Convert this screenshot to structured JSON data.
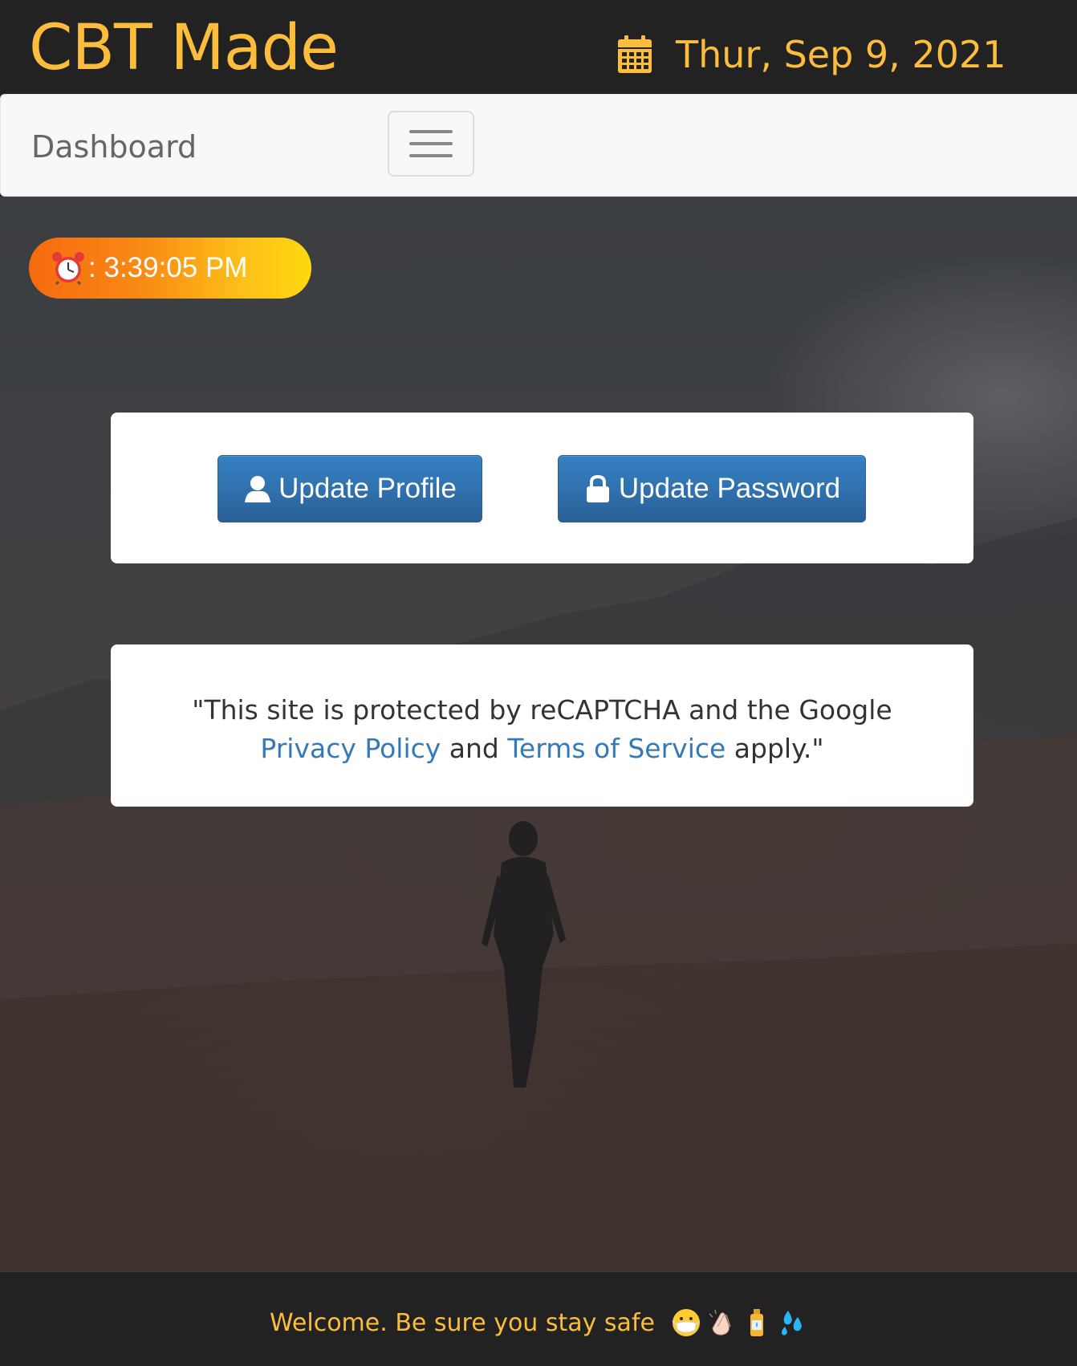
{
  "header": {
    "brand": "CBT Made",
    "date": "Thur, Sep 9, 2021",
    "brand_color": "#fbbd3b"
  },
  "navbar": {
    "brand_label": "Dashboard",
    "toggle_icon": "hamburger-menu-icon"
  },
  "clock": {
    "icon": "alarm-clock-icon",
    "time": ": 3:39:05 PM"
  },
  "actions": {
    "update_profile": "Update Profile",
    "update_password": "Update Password",
    "profile_icon": "user-icon",
    "password_icon": "lock-icon",
    "button_color": "#337ab7"
  },
  "notice": {
    "prefix": "\"This site is protected by reCAPTCHA and the Google ",
    "privacy_link": "Privacy Policy",
    "and": " and ",
    "terms_link": "Terms of Service",
    "suffix": " apply.\"",
    "link_color": "#337ab7"
  },
  "footer": {
    "message": "Welcome. Be sure you stay safe",
    "emojis": [
      "face-with-mask-icon",
      "clapping-hands-icon",
      "sanitizer-bottle-icon",
      "water-droplets-icon"
    ]
  }
}
